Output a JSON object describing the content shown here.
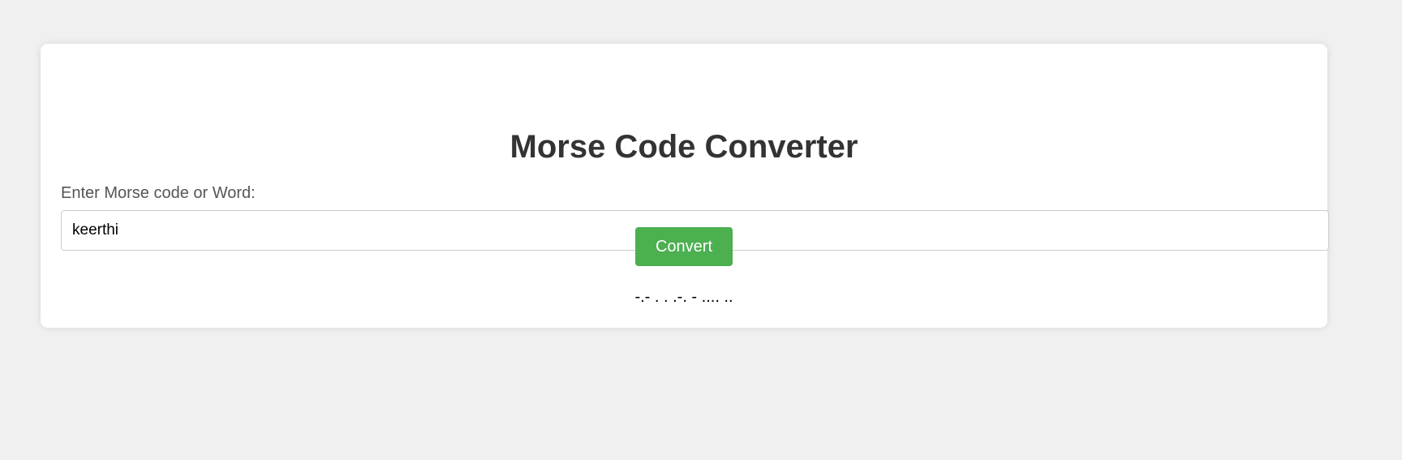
{
  "converter": {
    "title": "Morse Code Converter",
    "input_label": "Enter Morse code or Word:",
    "input_value": "keerthi",
    "button_label": "Convert",
    "result": "-.- . . .-. - .... .."
  },
  "colors": {
    "background": "#f0f0f0",
    "card": "#ffffff",
    "button": "#4caf50",
    "title": "#333333"
  }
}
